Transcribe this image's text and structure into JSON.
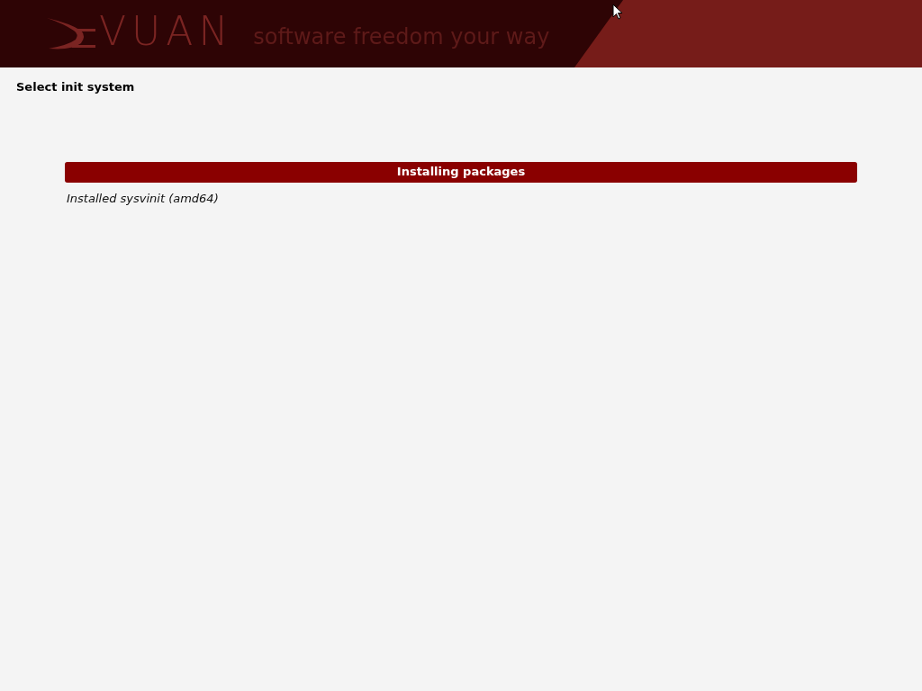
{
  "header": {
    "logo_text": "VUAN",
    "tagline": "software freedom your way"
  },
  "title": "Select init system",
  "progress": {
    "label": "Installing packages",
    "level": 1
  },
  "status": "Installed sysvinit (amd64)"
}
